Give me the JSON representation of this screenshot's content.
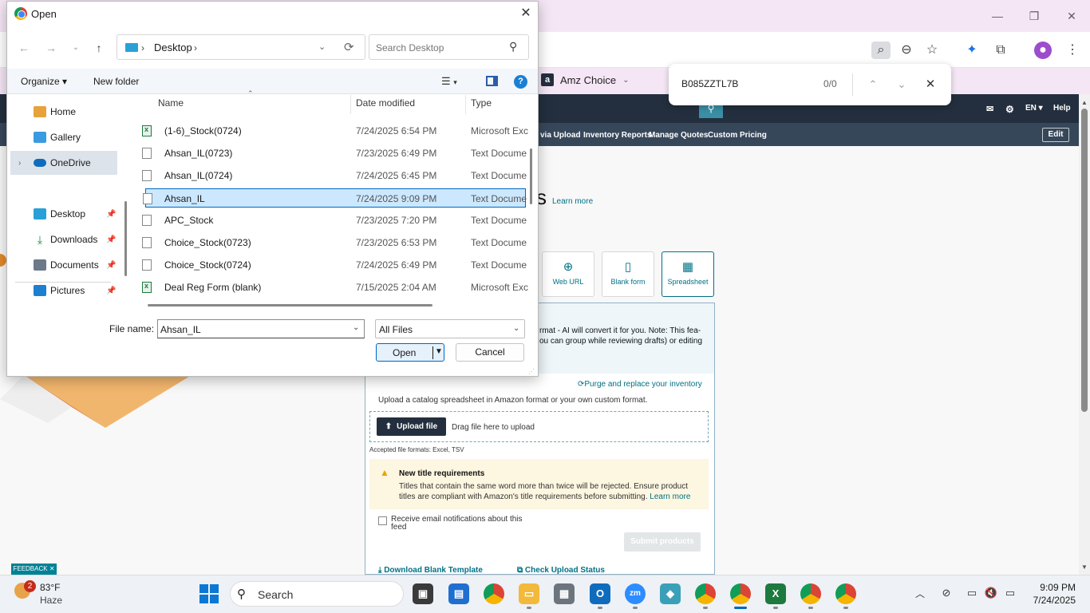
{
  "browser": {
    "tab_title": "Amz Choice",
    "tab_favicon": "a",
    "find": {
      "query": "B085ZZTL7B",
      "count": "0/0"
    },
    "nav1": {
      "lang": "EN ▾",
      "help": "Help"
    },
    "nav2": [
      "via Upload",
      "Inventory Reports",
      "Manage Quotes",
      "Custom Pricing"
    ],
    "edit": "Edit",
    "page_heading_fragment": "s",
    "learn_more": "Learn more",
    "source_tiles": [
      {
        "label": "Web URL",
        "icon": "globe-icon"
      },
      {
        "label": "Blank form",
        "icon": "document-icon"
      },
      {
        "label": "Spreadsheet",
        "icon": "spreadsheet-icon"
      }
    ],
    "info_text": "rmat - AI will convert it for you. Note: This fea- ou can group while reviewing drafts) or editing",
    "purge_link": "Purge and replace your inventory",
    "upload_desc": "Upload a catalog spreadsheet in Amazon format or your own custom format.",
    "upload_button": "Upload file",
    "drag_text": "Drag file here to upload",
    "accepted": "Accepted file formats: Excel, TSV",
    "alert_title": "New title requirements",
    "alert_text": "Titles that contain the same word more than twice will be rejected. Ensure product titles are compliant with Amazon's title requirements before submitting.",
    "alert_link": "Learn more",
    "email_label": "Receive email notifications about this feed",
    "submit": "Submit products",
    "download_template": "Download Blank Template",
    "check_status": "Check Upload Status",
    "feedback": "FEEDBACK ✕",
    "accent": "#007185"
  },
  "dialog": {
    "title": "Open",
    "address": {
      "location": "Desktop"
    },
    "search_placeholder": "Search Desktop",
    "organize": "Organize ▾",
    "new_folder": "New folder",
    "nav": [
      {
        "label": "Home",
        "icon": "home-icon",
        "pinned": false
      },
      {
        "label": "Gallery",
        "icon": "gallery-icon",
        "pinned": false
      },
      {
        "label": "OneDrive",
        "icon": "cloud-icon",
        "pinned": false
      },
      {
        "label": "Desktop",
        "icon": "desktop-icon",
        "pinned": true
      },
      {
        "label": "Downloads",
        "icon": "download-icon",
        "pinned": true
      },
      {
        "label": "Documents",
        "icon": "documents-icon",
        "pinned": true
      },
      {
        "label": "Pictures",
        "icon": "pictures-icon",
        "pinned": true
      }
    ],
    "columns": [
      "Name",
      "Date modified",
      "Type"
    ],
    "files": [
      {
        "name": "(1-6)_Stock(0724)",
        "date": "7/24/2025 6:54 PM",
        "type": "Microsoft Exc",
        "kind": "excel"
      },
      {
        "name": "Ahsan_IL(0723)",
        "date": "7/23/2025 6:49 PM",
        "type": "Text Docume",
        "kind": "text"
      },
      {
        "name": "Ahsan_IL(0724)",
        "date": "7/24/2025 6:45 PM",
        "type": "Text Docume",
        "kind": "text"
      },
      {
        "name": "Ahsan_IL",
        "date": "7/24/2025 9:09 PM",
        "type": "Text Docume",
        "kind": "text",
        "selected": true
      },
      {
        "name": "APC_Stock",
        "date": "7/23/2025 7:20 PM",
        "type": "Text Docume",
        "kind": "text"
      },
      {
        "name": "Choice_Stock(0723)",
        "date": "7/23/2025 6:53 PM",
        "type": "Text Docume",
        "kind": "text"
      },
      {
        "name": "Choice_Stock(0724)",
        "date": "7/24/2025 6:49 PM",
        "type": "Text Docume",
        "kind": "text"
      },
      {
        "name": "Deal Reg Form (blank)",
        "date": "7/15/2025 2:04 AM",
        "type": "Microsoft Exc",
        "kind": "excel"
      }
    ],
    "file_name_label": "File name:",
    "file_name_value": "Ahsan_IL",
    "file_type": "All Files",
    "open": "Open",
    "cancel": "Cancel"
  },
  "taskbar": {
    "weather_badge": "2",
    "temp": "83°F",
    "condition": "Haze",
    "search": "Search",
    "time": "9:09 PM",
    "date": "7/24/2025"
  }
}
